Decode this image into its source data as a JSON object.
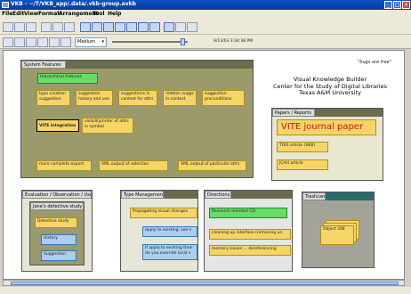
{
  "window": {
    "title": "VKB - ~/T/VKB_app/.data/.vkb-group.avkb"
  },
  "menu": {
    "items": [
      "File",
      "Edit",
      "View",
      "Format",
      "Arrangement",
      "Tool",
      "Help"
    ]
  },
  "toolbar": {
    "zoom_level": "Medium",
    "timestamp": "9/13/03 3:34:38 PM"
  },
  "canvas": {
    "heading_lines": [
      "Visual Knowledge Builder",
      "Center for the Study of Digital Libraries",
      "Texas A&M University"
    ],
    "bugs_note": "\"bugs are free\""
  },
  "panels": {
    "system_features": {
      "title": "System Features",
      "notes": [
        "Hierarchical features",
        "type creation suggestion",
        "suggestion history and use",
        "suggestions in context for attrs",
        "relation suggs in context",
        "suggestion preconditions",
        "VITE integration",
        "visibility/order of attrs in symbol",
        "more complete export",
        "XML output of selection",
        "XML output of particular attrs"
      ]
    },
    "papers": {
      "title": "Papers / Reports",
      "notes": [
        "VITE journal paper",
        "TOIS article (VKB)",
        "JCAH article"
      ]
    },
    "evaluation": {
      "title": "Evaluation / Observation / Use",
      "study_title": "Jane's detective study",
      "notes": [
        "Detective study",
        "History",
        "Suggestion"
      ]
    },
    "type_mgmt": {
      "title": "Type Management",
      "notes": [
        "Propagating visual changes",
        "apply to existing: see s",
        "If apply to existing then do you override local v"
      ]
    },
    "directions": {
      "title": "Directions",
      "notes": [
        "Research oriented CD",
        "cleaning up interface (removing un",
        "memory issues ... dereferencing"
      ]
    },
    "trashcan": {
      "title": "Trashcan",
      "notes": [
        "Object 308"
      ]
    }
  },
  "colors": {
    "note_yellow": "#f5d565",
    "note_green": "#66dd66",
    "note_blue": "#a8d0ee",
    "panel_olive": "#9a9a6a",
    "papers_bg": "#e7e8cf",
    "directions_bg": "#e5e5e5",
    "trash_bg": "#a3a39a",
    "title_bar": "#0a52c4",
    "big_red_text": "#d01818"
  }
}
